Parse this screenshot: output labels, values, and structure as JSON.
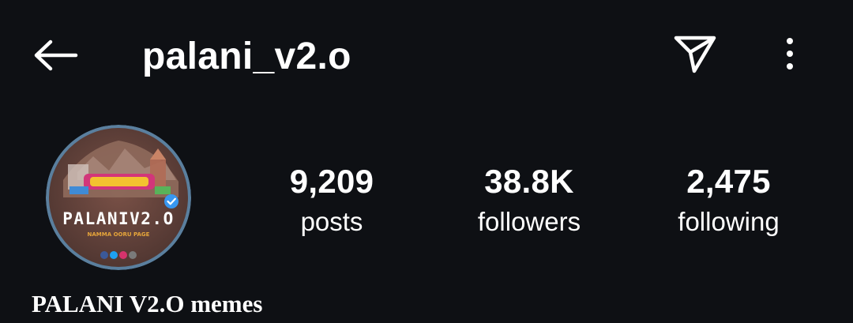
{
  "header": {
    "back_icon": "arrow-left-icon",
    "username": "palani_v2.o",
    "direct_icon": "paper-plane-icon",
    "more_icon": "more-vertical-icon"
  },
  "profile": {
    "avatar_text": "PALANIV2.O",
    "avatar_subtext": "NAMMA OORU PAGE",
    "verified_icon": "verified-check-icon",
    "display_name": "PALANI V2.O memes"
  },
  "stats": {
    "posts": {
      "count": "9,209",
      "label": "posts"
    },
    "followers": {
      "count": "38.8K",
      "label": "followers"
    },
    "following": {
      "count": "2,475",
      "label": "following"
    }
  },
  "colors": {
    "background": "#0e1014",
    "text": "#ffffff",
    "verified": "#3897f0"
  }
}
